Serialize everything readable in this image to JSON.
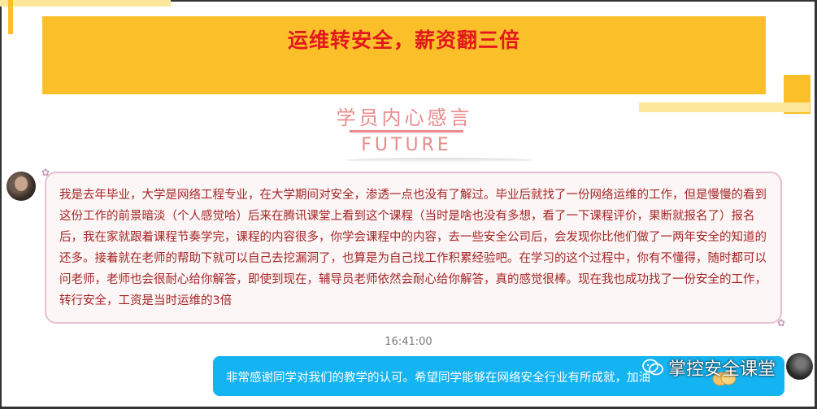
{
  "banner": {
    "title": "运维转安全，薪资翻三倍"
  },
  "header": {
    "subtitle": "学员内心感言",
    "future": "FUTURE"
  },
  "chat": {
    "message": "我是去年毕业，大学是网络工程专业，在大学期间对安全，渗透一点也没有了解过。毕业后就找了一份网络运维的工作，但是慢慢的看到这份工作的前景暗淡（个人感觉哈）后来在腾讯课堂上看到这个课程（当时是啥也没有多想，看了一下课程评价，果断就报名了）报名后，我在家就跟着课程节奏学完，课程的内容很多，你学会课程中的内容，去一些安全公司后，会发现你比他们做了一两年安全的知道的还多。接着就在老师的帮助下就可以自己去挖漏洞了，也算是为自己找工作积累经验吧。在学习的这个过程中，你有不懂得，随时都可以问老师，老师也会很耐心给你解答，即使到现在，辅导员老师依然会耐心给你解答，真的感觉很棒。现在我也成功找了一份安全的工作，转行安全，工资是当时运维的3倍",
    "timestamp": "16:41:00",
    "reply": "非常感谢同学对我们的教学的认可。希望同学能够在网络安全行业有所成就，加油"
  },
  "watermark": {
    "text": "掌控安全课堂",
    "icon": "wechat-icon"
  },
  "colors": {
    "banner": "#fbbf2a",
    "title": "#e3181d",
    "accent": "#e98b8b",
    "reply": "#14b3f1",
    "message": "#a52626"
  }
}
